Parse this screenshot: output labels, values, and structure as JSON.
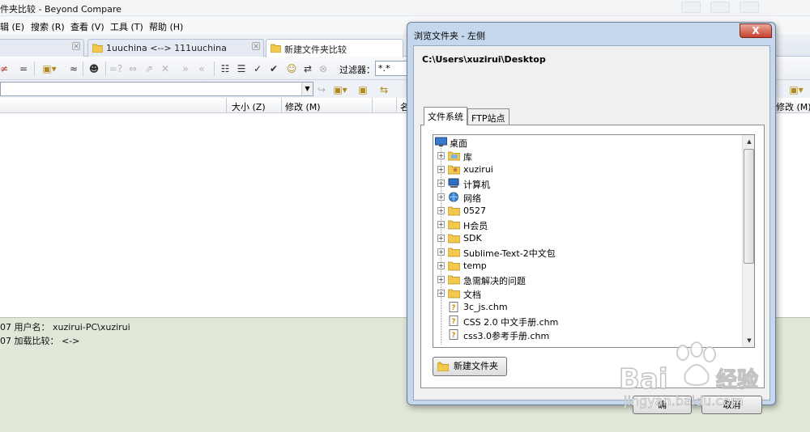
{
  "window": {
    "title": "件夹比较 - Beyond Compare"
  },
  "menu": [
    "辑 (E)",
    "搜索 (R)",
    "查看 (V)",
    "工具 (T)",
    "帮助 (H)"
  ],
  "tabs": [
    {
      "label": "1uuchina <--> 111uuchina"
    },
    {
      "label": "新建文件夹比较"
    }
  ],
  "toolbar": {
    "filter_label": "过滤器：",
    "filter_value": "*.*"
  },
  "columns": {
    "size": "大小 (Z)",
    "modified": "修改 (M)",
    "name_partial": "名",
    "modified_right": "修改 (M)"
  },
  "log": [
    "07  用户名：  xuzirui-PC\\xuzirui",
    "07  加载比较：  <->"
  ],
  "dialog": {
    "title": "浏览文件夹 - 左侧",
    "close": "X",
    "current_path": "C:\\Users\\xuzirui\\Desktop",
    "tabs": [
      "文件系统",
      "FTP站点"
    ],
    "tree": [
      {
        "label": "桌面",
        "icon": "desktop-icon"
      },
      {
        "label": "库",
        "icon": "library-icon"
      },
      {
        "label": "xuzirui",
        "icon": "user-folder-icon"
      },
      {
        "label": "计算机",
        "icon": "computer-icon"
      },
      {
        "label": "网络",
        "icon": "network-icon"
      },
      {
        "label": "0527",
        "icon": "folder-icon"
      },
      {
        "label": "H会员",
        "icon": "folder-icon"
      },
      {
        "label": "SDK",
        "icon": "folder-icon"
      },
      {
        "label": "Sublime-Text-2中文包",
        "icon": "folder-icon"
      },
      {
        "label": "temp",
        "icon": "folder-icon"
      },
      {
        "label": "急需解决的问题",
        "icon": "folder-icon"
      },
      {
        "label": "文档",
        "icon": "folder-icon"
      },
      {
        "label": "3c_js.chm",
        "icon": "chm-file-icon"
      },
      {
        "label": "CSS 2.0 中文手册.chm",
        "icon": "chm-file-icon"
      },
      {
        "label": "css3.0参考手册.chm",
        "icon": "chm-file-icon"
      }
    ],
    "new_folder": "新建文件夹",
    "ok": "确",
    "cancel": "取消"
  },
  "watermark": {
    "brand": "Bai",
    "brand_suffix": "经验",
    "url": "jingyan.baidu.com"
  },
  "colors": {
    "dialog_frame": "#c5d7ec",
    "close_red": "#c7412c",
    "log_bg": "#dfe7d8",
    "folder": "#f2c94c"
  }
}
